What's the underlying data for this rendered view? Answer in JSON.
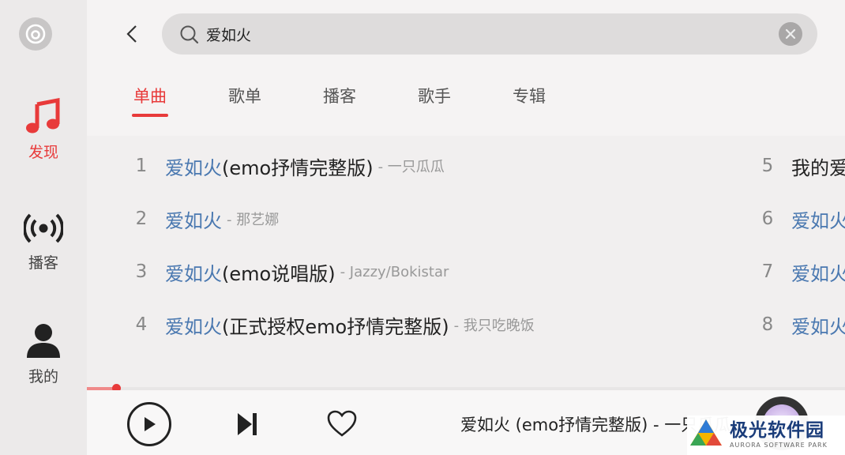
{
  "sidebar": {
    "items": [
      {
        "label": "发现",
        "icon": "music-note-icon",
        "active": true
      },
      {
        "label": "播客",
        "icon": "broadcast-icon",
        "active": false
      },
      {
        "label": "我的",
        "icon": "user-icon",
        "active": false
      }
    ]
  },
  "search": {
    "value": "爱如火"
  },
  "tabs": [
    {
      "label": "单曲",
      "active": true
    },
    {
      "label": "歌单",
      "active": false
    },
    {
      "label": "播客",
      "active": false
    },
    {
      "label": "歌手",
      "active": false
    },
    {
      "label": "专辑",
      "active": false
    }
  ],
  "results": [
    {
      "index": "1",
      "title_highlight": "爱如火",
      "title_rest": " (emo抒情完整版)",
      "artist": "- 一只瓜瓜"
    },
    {
      "index": "2",
      "title_highlight": "爱如火",
      "title_rest": "",
      "artist": "- 那艺娜"
    },
    {
      "index": "3",
      "title_highlight": "爱如火",
      "title_rest": " (emo说唱版)",
      "artist": "- Jazzy/Bokistar"
    },
    {
      "index": "4",
      "title_highlight": "爱如火",
      "title_rest": " (正式授权emo抒情完整版)",
      "artist": "- 我只吃晚饭"
    },
    {
      "index": "5",
      "title_highlight": "",
      "title_rest": "我的爱",
      "artist": ""
    },
    {
      "index": "6",
      "title_highlight": "爱如火",
      "title_rest": "",
      "artist": ""
    },
    {
      "index": "7",
      "title_highlight": "爱如火",
      "title_rest": "",
      "artist": ""
    },
    {
      "index": "8",
      "title_highlight": "爱如火",
      "title_rest": "",
      "artist": ""
    }
  ],
  "player": {
    "now_playing": "爱如火 (emo抒情完整版) - 一只瓜瓜",
    "progress": 0.04
  },
  "watermark": {
    "main": "极光软件园",
    "sub": "AURORA SOFTWARE PARK"
  },
  "colors": {
    "accent": "#e83a3a",
    "highlight": "#4a78b0"
  }
}
